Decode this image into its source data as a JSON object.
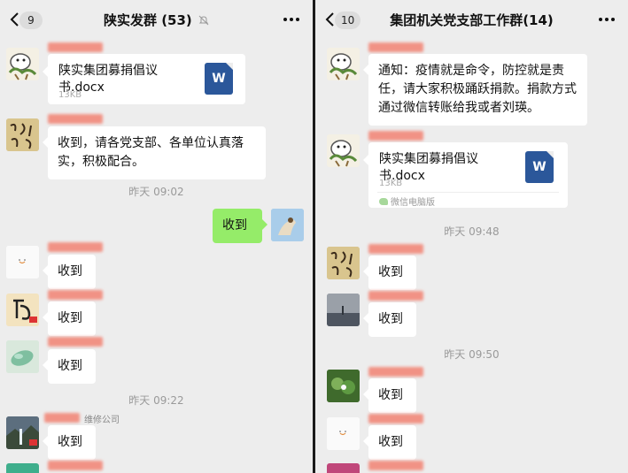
{
  "left": {
    "header": {
      "badge": "9",
      "title": "陕实发群 (53)",
      "muted": true
    },
    "file": {
      "name": "陕实集团募捐倡议书.docx",
      "size": "13KB",
      "icon_label": "W"
    },
    "message_1": "收到，请各党支部、各单位认真落实，积极配合。",
    "time_1": "昨天 09:02",
    "my_reply": "收到",
    "replies": [
      "收到",
      "收到",
      "收到"
    ],
    "time_2": "昨天 09:22",
    "company_tag": "维修公司",
    "reply_after_time": "收到"
  },
  "right": {
    "header": {
      "badge": "10",
      "title": "集团机关党支部工作群(14)"
    },
    "notice": "通知：疫情就是命令，防控就是责任，请大家积极踊跃捐款。捐款方式通过微信转账给我或者刘瑛。",
    "file": {
      "name": "陕实集团募捐倡议书.docx",
      "size": "13KB",
      "icon_label": "W",
      "source": "微信电脑版"
    },
    "time_1": "昨天 09:48",
    "replies_1": [
      "收到",
      "收到"
    ],
    "time_2": "昨天 09:50",
    "replies_2": [
      "收到",
      "收到"
    ]
  },
  "icons": {
    "back": "chevron-left-icon",
    "more": "more-dots-icon",
    "mute": "bell-muted-icon",
    "file": "word-document-icon"
  },
  "colors": {
    "background": "#ededed",
    "bubble": "#ffffff",
    "my_bubble": "#95ec69",
    "name_redacted": "#f2897a",
    "word_blue": "#2b579a"
  }
}
